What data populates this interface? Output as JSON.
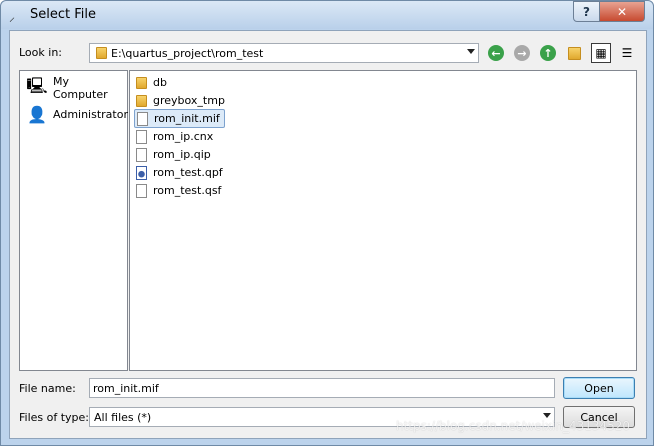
{
  "window": {
    "title": "Select File",
    "help_label": "?",
    "close_label": "✕"
  },
  "toolbar": {
    "look_in_label": "Look in:",
    "path": "E:\\quartus_project\\rom_test",
    "icons": [
      "back-icon",
      "forward-icon",
      "up-folder-icon",
      "new-folder-icon",
      "list-view-icon",
      "detail-view-icon"
    ]
  },
  "sidebar": {
    "items": [
      {
        "label": "My Computer",
        "icon": "computer-icon"
      },
      {
        "label": "Administrator",
        "icon": "user-icon"
      }
    ]
  },
  "files": [
    {
      "name": "db",
      "type": "folder"
    },
    {
      "name": "greybox_tmp",
      "type": "folder"
    },
    {
      "name": "rom_init.mif",
      "type": "file",
      "selected": true
    },
    {
      "name": "rom_ip.cnx",
      "type": "file"
    },
    {
      "name": "rom_ip.qip",
      "type": "file"
    },
    {
      "name": "rom_test.qpf",
      "type": "project"
    },
    {
      "name": "rom_test.qsf",
      "type": "file"
    }
  ],
  "footer": {
    "file_name_label": "File name:",
    "file_name_value": "rom_init.mif",
    "files_of_type_label": "Files of type:",
    "files_of_type_value": "All files (*)",
    "open_label": "Open",
    "cancel_label": "Cancel"
  },
  "watermark": "https://blog.csdn.net/weixin_43134520",
  "colors": {
    "title_gradient_top": "#dbe8f6",
    "close_button": "#c74a30",
    "selection": "#dceaf8",
    "back_forward_green": "#3aa14a"
  }
}
